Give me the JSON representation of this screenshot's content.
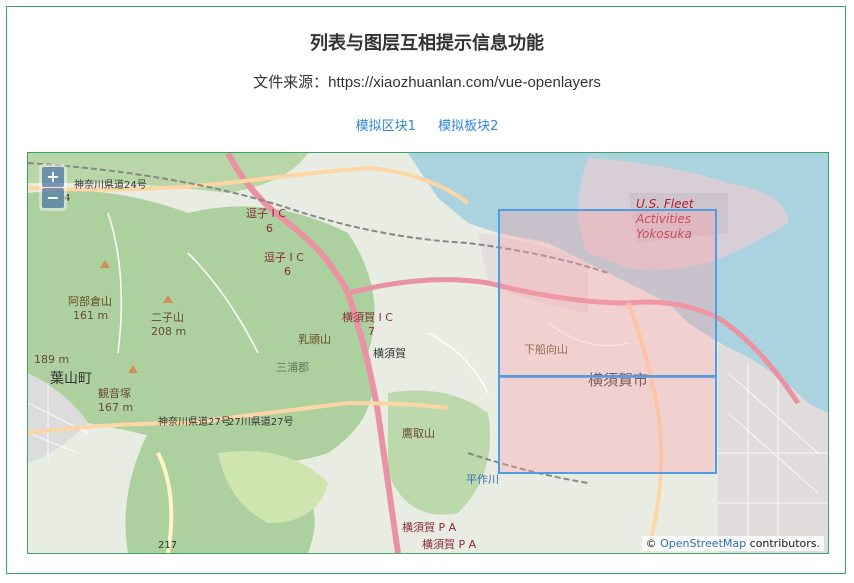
{
  "page": {
    "title": "列表与图层互相提示信息功能",
    "source_prefix": "文件来源：",
    "source_url": "https://xiaozhuanlan.com/vue-openlayers"
  },
  "tabs": [
    {
      "label": "模拟区块1"
    },
    {
      "label": "模拟板块2"
    }
  ],
  "map": {
    "zoom_in": "+",
    "zoom_out": "−",
    "attribution_prefix": "©",
    "attribution_link": "OpenStreetMap",
    "attribution_suffix": "contributors.",
    "labels": {
      "us_fleet_1": "U.S. Fleet",
      "us_fleet_2": "Activities",
      "us_fleet_3": "Yokosuka",
      "yokosuka_city": "横須賀市",
      "hayama": "葉山町",
      "abekura": "阿部倉山",
      "abekura_h": "161 m",
      "futago": "二子山",
      "futago_h": "208 m",
      "kannon": "観音塚",
      "kannon_h": "167 m",
      "h189": "189 m",
      "nyuto": "乳頭山",
      "miura": "三浦郡",
      "zushi_ic_1": "逗子 I C",
      "zushi_ic_2": "逗子 I C",
      "num6a": "6",
      "num6b": "6",
      "yokosuka_ic": "横須賀 I C",
      "num7": "7",
      "yokosuka": "横須賀",
      "takatori": "鷹取山",
      "shimo": "下船向山",
      "pa1": "横須賀 P A",
      "pa2": "横須賀 P A",
      "route24": "神奈川県道24号",
      "route27": "神奈川県道27号",
      "route27b": "27川県道27号",
      "route217": "217",
      "num4": "4",
      "river": "平作川"
    },
    "colors": {
      "water": "#aad3df",
      "forest": "#add19e",
      "urban": "#f2dad9",
      "motorway": "#e892a2",
      "primary": "#fcd6a4",
      "block_stroke": "#4d9ee6",
      "block_fill": "#ffa0aa"
    }
  }
}
